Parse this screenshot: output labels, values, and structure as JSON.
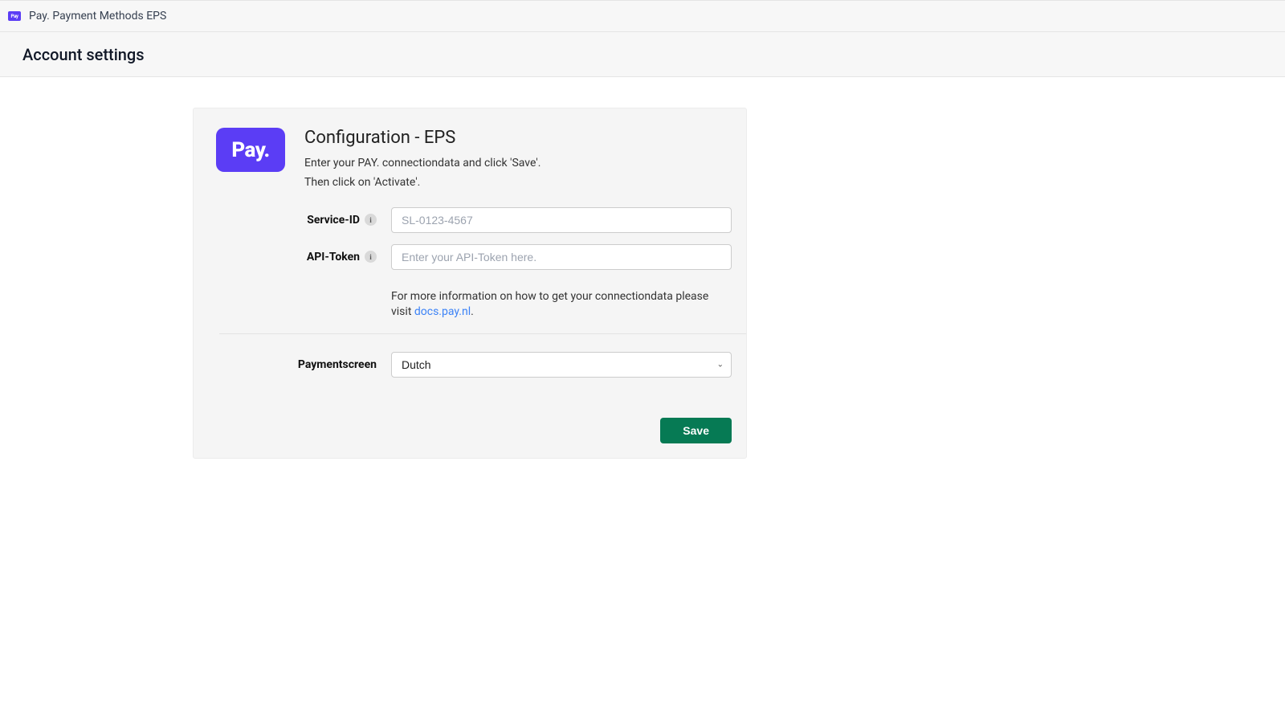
{
  "topbar": {
    "app_icon_label": "Pay",
    "title": "Pay. Payment Methods EPS"
  },
  "page": {
    "title": "Account settings"
  },
  "logo": {
    "text": "Pay."
  },
  "config": {
    "heading": "Configuration - EPS",
    "intro_line1": "Enter your PAY. connectiondata and click 'Save'.",
    "intro_line2": "Then click on 'Activate'.",
    "fields": {
      "service_id": {
        "label": "Service-ID",
        "placeholder": "SL-0123-4567",
        "value": ""
      },
      "api_token": {
        "label": "API-Token",
        "placeholder": "Enter your API-Token here.",
        "value": ""
      }
    },
    "help": {
      "prefix": "For more information on how to get your connectiondata please visit ",
      "link_text": "docs.pay.nl",
      "suffix": "."
    },
    "paymentscreen": {
      "label": "Paymentscreen",
      "selected": "Dutch"
    },
    "actions": {
      "save": "Save"
    }
  },
  "icons": {
    "info_glyph": "i",
    "caret_glyph": "⌄"
  },
  "colors": {
    "brand": "#5b3df5",
    "save_button": "#067a54",
    "link": "#3b82f6"
  }
}
